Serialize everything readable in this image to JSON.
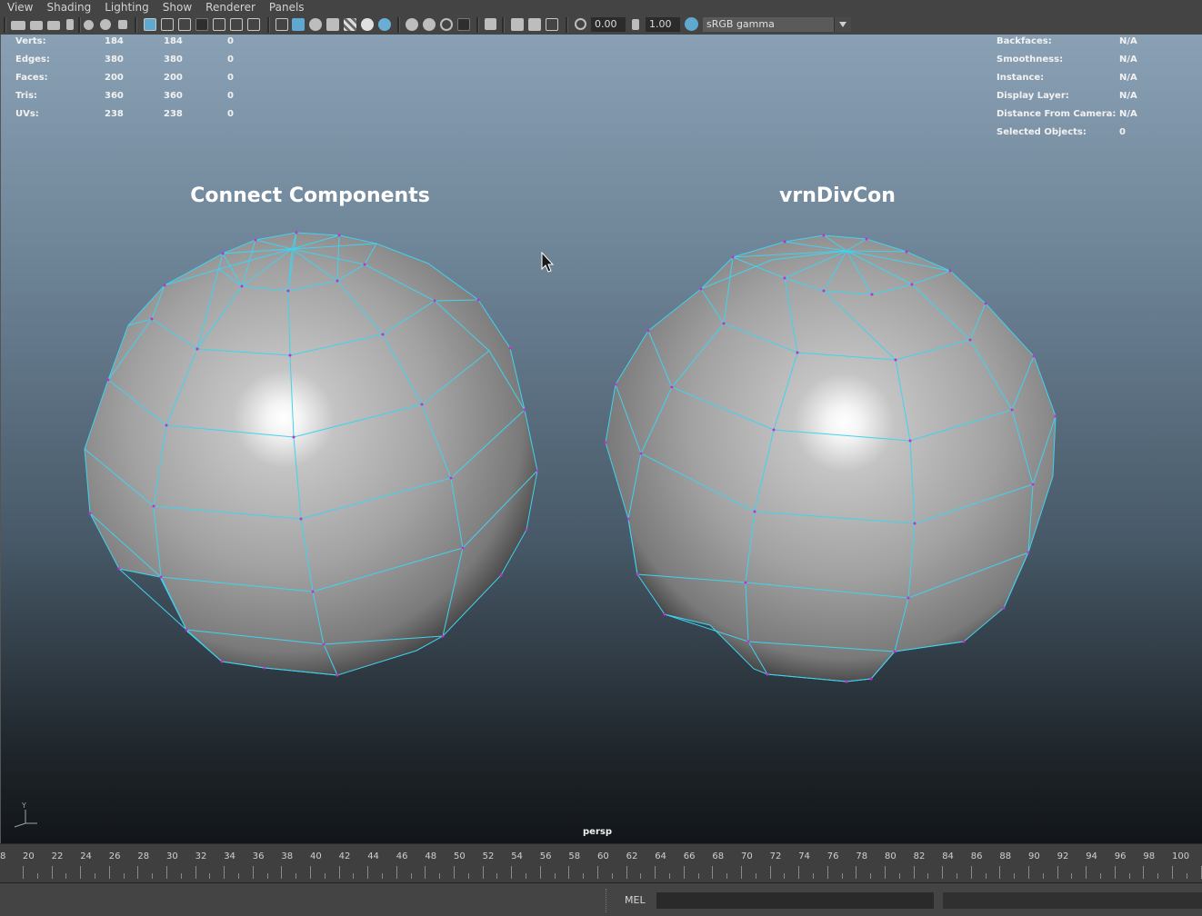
{
  "menubar": {
    "items": [
      "View",
      "Shading",
      "Lighting",
      "Show",
      "Renderer",
      "Panels"
    ]
  },
  "toolbar": {
    "exposure_value": "0.00",
    "gamma_value": "1.00",
    "color_space": "sRGB gamma",
    "icons": [
      "camera-select-icon",
      "camera-attr-icon",
      "bookmark-icon",
      "image-plane-icon",
      "grease-pencil-icon",
      "grid-icon",
      "film-gate-icon",
      "resolution-gate-icon",
      "gate-mask-icon",
      "field-chart-icon",
      "safe-action-icon",
      "safe-title-icon",
      "wireframe-icon",
      "smooth-shade-icon",
      "wireframe-on-shaded-icon",
      "default-material-icon",
      "textured-icon",
      "lights-icon",
      "shadows-icon",
      "ambient-occlusion-icon",
      "motion-blur-icon",
      "isolate-select-icon",
      "xray-icon",
      "xray-joints-icon",
      "xray-active-icon",
      "exposure-icon",
      "gamma-icon",
      "color-management-icon"
    ],
    "accent": "#5fa9d1"
  },
  "hud_left": {
    "rows": [
      {
        "label": "Verts:",
        "a": "184",
        "b": "184",
        "c": "0"
      },
      {
        "label": "Edges:",
        "a": "380",
        "b": "380",
        "c": "0"
      },
      {
        "label": "Faces:",
        "a": "200",
        "b": "200",
        "c": "0"
      },
      {
        "label": "Tris:",
        "a": "360",
        "b": "360",
        "c": "0"
      },
      {
        "label": "UVs:",
        "a": "238",
        "b": "238",
        "c": "0"
      }
    ]
  },
  "hud_right": {
    "rows": [
      {
        "label": "Backfaces:",
        "value": "N/A"
      },
      {
        "label": "Smoothness:",
        "value": "N/A"
      },
      {
        "label": "Instance:",
        "value": "N/A"
      },
      {
        "label": "Display Layer:",
        "value": "N/A"
      },
      {
        "label": "Distance From Camera:",
        "value": "N/A"
      },
      {
        "label": "Selected Objects:",
        "value": "0"
      }
    ]
  },
  "scene": {
    "left_label": "Connect Components",
    "right_label": "vrnDivCon",
    "camera": "persp",
    "axis_label": "Y",
    "wire_color": "#3fd3f0",
    "vertex_color": "#c030d0"
  },
  "timeline": {
    "labels": [
      "8",
      "20",
      "22",
      "24",
      "26",
      "28",
      "30",
      "32",
      "34",
      "36",
      "38",
      "40",
      "42",
      "44",
      "46",
      "48",
      "50",
      "52",
      "54",
      "56",
      "58",
      "60",
      "62",
      "64",
      "66",
      "68",
      "70",
      "72",
      "74",
      "76",
      "78",
      "80",
      "82",
      "84",
      "86",
      "88",
      "90",
      "92",
      "94",
      "96",
      "98",
      "100"
    ]
  },
  "command_line": {
    "language": "MEL"
  }
}
